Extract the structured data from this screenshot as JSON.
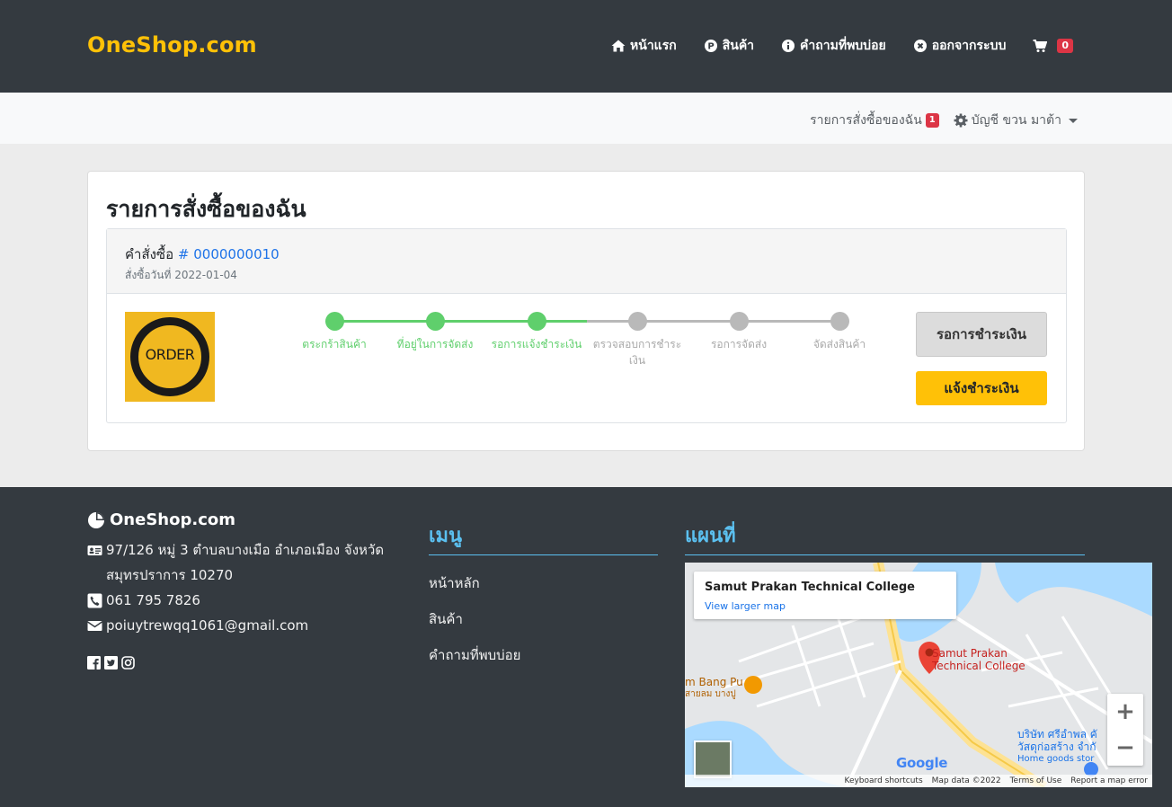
{
  "brand": "OneShop.com",
  "nav": {
    "home": "หน้าแรก",
    "products": "สินค้า",
    "faq": "คำถามที่พบบ่อย",
    "logout": "ออกจากระบบ",
    "cart_count": "0"
  },
  "subbar": {
    "my_orders": "รายการสั่งซื้อของฉัน",
    "my_orders_count": "1",
    "account": "บัญชี ขวน มาต้า"
  },
  "page": {
    "title": "รายการสั่งซื้อของฉัน",
    "order_label": "คำสั่งซื้อ",
    "order_number": "# 0000000010",
    "order_date": "สั่งซื้อวันที่ 2022-01-04",
    "order_image_text": "ORDER",
    "steps": [
      {
        "label": "ตระกร้าสินค้า",
        "status": "done"
      },
      {
        "label": "ที่อยู่ในการจัดส่ง",
        "status": "done"
      },
      {
        "label": "รอการแจ้งชำระเงิน",
        "status": "done"
      },
      {
        "label": "ตรวจสอบการชำระเงิน",
        "status": "todo"
      },
      {
        "label": "รอการจัดส่ง",
        "status": "todo"
      },
      {
        "label": "จัดส่งสินค้า",
        "status": "todo"
      }
    ],
    "status_button": "รอการชำระเงิน",
    "pay_button": "แจ้งชำระเงิน"
  },
  "footer": {
    "brand": "OneShop.com",
    "address": "97/126 หมู่ 3 ตำบลบางเมือ อำเภอเมือง จังหวัด สมุทรปราการ 10270",
    "phone": "061 795 7826",
    "email": "poiuytrewqq1061@gmail.com",
    "menu_title": "เมนู",
    "menu_items": [
      "หน้าหลัก",
      "สินค้า",
      "คำถามที่พบบ่อย"
    ],
    "map_title": "แผนที่"
  },
  "map": {
    "place_name": "Samut Prakan Technical College",
    "view_larger": "View larger map",
    "pin_label_1": "Samut Prakan",
    "pin_label_2": "Technical College",
    "poi_1": "m Bang Pu",
    "poi_1_th": "สายลม บางปู",
    "poi_2_th_1": "บริษัท ศรีอำพล คั",
    "poi_2_th_2": "วัสดุก่อสร้าง จำกั",
    "poi_2_en": "Home goods stor",
    "google": "Google",
    "footer_links": [
      "Keyboard shortcuts",
      "Map data ©2022",
      "Terms of Use",
      "Report a map error"
    ]
  },
  "colors": {
    "navbar": "#343a40",
    "brand": "#ffc107",
    "done": "#5fcf6c",
    "todo": "#b9b9b9",
    "link": "#1e73e8",
    "footer_accent": "#5bc0f0"
  }
}
